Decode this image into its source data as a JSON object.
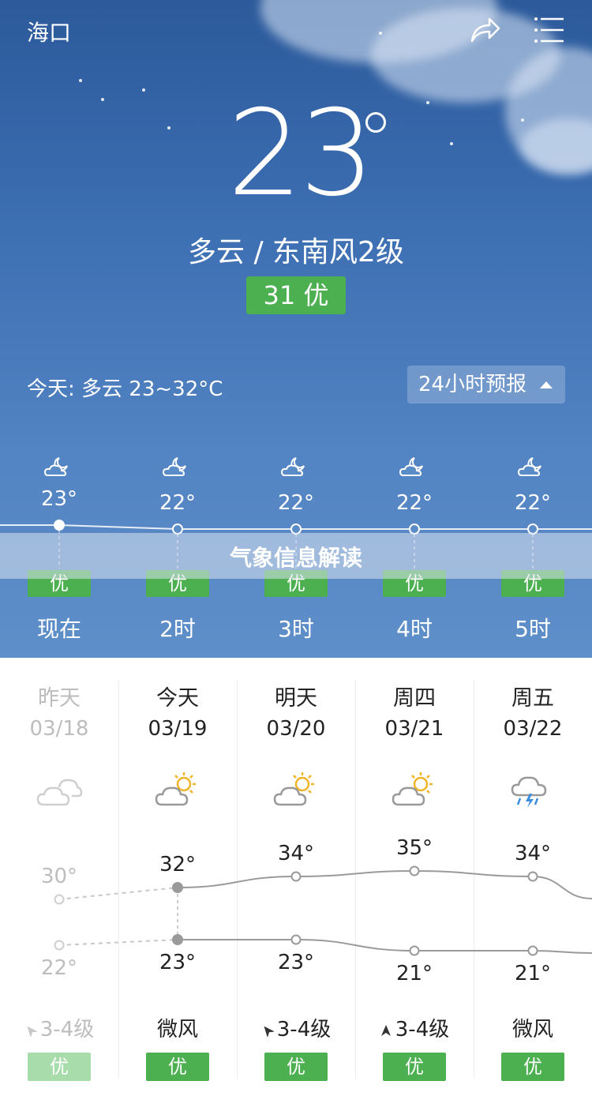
{
  "header": {
    "city": "海口"
  },
  "current": {
    "temp": "23",
    "condition": "多云  /  东南风2级",
    "aqi": "31 优"
  },
  "today_summary": {
    "text": "今天:  多云   23~32°C",
    "forecast_button": "24小时预报"
  },
  "hourly": [
    {
      "label": "现在",
      "temp": "23°",
      "temp_value": 23,
      "aqi": "优",
      "icon": "moon-cloud-icon"
    },
    {
      "label": "2时",
      "temp": "22°",
      "temp_value": 22,
      "aqi": "优",
      "icon": "moon-cloud-icon"
    },
    {
      "label": "3时",
      "temp": "22°",
      "temp_value": 22,
      "aqi": "优",
      "icon": "moon-cloud-icon"
    },
    {
      "label": "4时",
      "temp": "22°",
      "temp_value": 22,
      "aqi": "优",
      "icon": "moon-cloud-icon"
    },
    {
      "label": "5时",
      "temp": "22°",
      "temp_value": 22,
      "aqi": "优",
      "icon": "moon-cloud-icon"
    }
  ],
  "banner": {
    "text": "气象信息解读"
  },
  "daily": [
    {
      "name": "昨天",
      "date": "03/18",
      "high": "30°",
      "low": "22°",
      "high_value": 30,
      "low_value": 22,
      "wind": "3-4级",
      "aqi": "优",
      "icon": "cloudy-icon",
      "past": true
    },
    {
      "name": "今天",
      "date": "03/19",
      "high": "32°",
      "low": "23°",
      "high_value": 32,
      "low_value": 23,
      "wind": "微风",
      "aqi": "优",
      "icon": "partly-sunny-icon",
      "past": false
    },
    {
      "name": "明天",
      "date": "03/20",
      "high": "34°",
      "low": "23°",
      "high_value": 34,
      "low_value": 23,
      "wind": "3-4级",
      "aqi": "优",
      "icon": "partly-sunny-icon",
      "past": false
    },
    {
      "name": "周四",
      "date": "03/21",
      "high": "35°",
      "low": "21°",
      "high_value": 35,
      "low_value": 21,
      "wind": "3-4级",
      "aqi": "优",
      "icon": "partly-sunny-icon",
      "past": false
    },
    {
      "name": "周五",
      "date": "03/22",
      "high": "34°",
      "low": "21°",
      "high_value": 34,
      "low_value": 21,
      "wind": "微风",
      "aqi": "优",
      "icon": "thunderstorm-icon",
      "past": false
    }
  ],
  "colors": {
    "aqi_good": "#4caf50",
    "sky_top": "#2c5a9b",
    "sky_bottom": "#5f8fc9"
  }
}
